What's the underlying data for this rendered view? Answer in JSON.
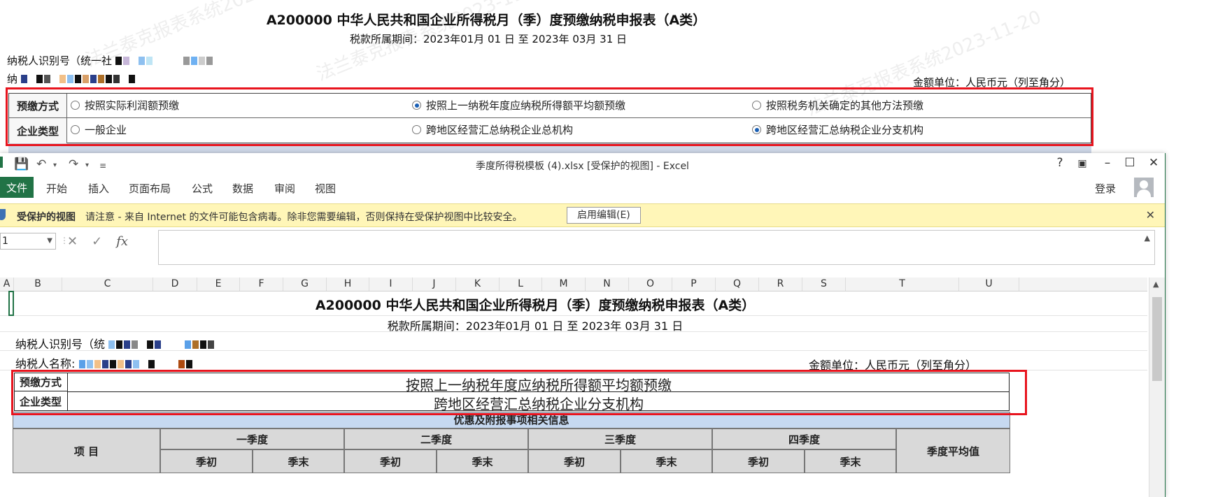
{
  "bg_form": {
    "title": "A200000 中华人民共和国企业所得税月（季）度预缴纳税申报表（A类）",
    "period": "税款所属期间：2023年01月 01 日 至 2023年 03月 31 日",
    "taxpayer_id_label": "纳税人识别号（统一社",
    "taxpayer_name_label": "纳",
    "unit": "金额单位：人民币元（列至角分）",
    "rows": [
      {
        "header": "预缴方式",
        "options": [
          {
            "label": "按照实际利润额预缴",
            "selected": false
          },
          {
            "label": "按照上一纳税年度应纳税所得额平均额预缴",
            "selected": true
          },
          {
            "label": "按照税务机关确定的其他方法预缴",
            "selected": false
          }
        ]
      },
      {
        "header": "企业类型",
        "options": [
          {
            "label": "一般企业",
            "selected": false
          },
          {
            "label": "跨地区经营汇总纳税企业总机构",
            "selected": false
          },
          {
            "label": "跨地区经营汇总纳税企业分支机构",
            "selected": true
          }
        ]
      }
    ],
    "watermark": "法兰泰克报表系统2023-11-20",
    "cut_band": "优惠及附报事项相关信息"
  },
  "excel": {
    "window_title": "季度所得税模板 (4).xlsx  [受保护的视图] - Excel",
    "tabs": {
      "file": "文件",
      "home": "开始",
      "insert": "插入",
      "layout": "页面布局",
      "formula": "公式",
      "data": "数据",
      "review": "审阅",
      "view": "视图"
    },
    "login": "登录",
    "protected": {
      "title": "受保护的视图",
      "message": "请注意 - 来自 Internet 的文件可能包含病毒。除非您需要编辑，否则保持在受保护视图中比较安全。",
      "button": "启用编辑(E)"
    },
    "namebox": "1",
    "columns": [
      "A",
      "B",
      "C",
      "D",
      "E",
      "F",
      "G",
      "H",
      "I",
      "J",
      "K",
      "L",
      "M",
      "N",
      "O",
      "P",
      "Q",
      "R",
      "S",
      "T",
      "U"
    ],
    "sheet": {
      "title": "A200000 中华人民共和国企业所得税月（季）度预缴纳税申报表（A类）",
      "period": "税款所属期间：2023年01月 01 日 至 2023年 03月 31 日",
      "taxpayer_id_label": "纳税人识别号（统",
      "taxpayer_name_label": "纳税人名称:",
      "unit": "金额单位：人民币元（列至角分）",
      "prepay_header": "预缴方式",
      "prepay_value": "按照上一纳税年度应纳税所得额平均额预缴",
      "type_header": "企业类型",
      "type_value": "跨地区经营汇总纳税企业分支机构",
      "band": "优惠及附报事项相关信息",
      "item_header": "项    目",
      "quarters": [
        "一季度",
        "二季度",
        "三季度",
        "四季度"
      ],
      "sub": [
        "季初",
        "季末"
      ],
      "avg": "季度平均值"
    }
  },
  "colors": {
    "excel_green": "#217346",
    "highlight_red": "#e8141e",
    "band_blue": "#c6d9f1",
    "prot_yellow": "#fff6b8"
  }
}
